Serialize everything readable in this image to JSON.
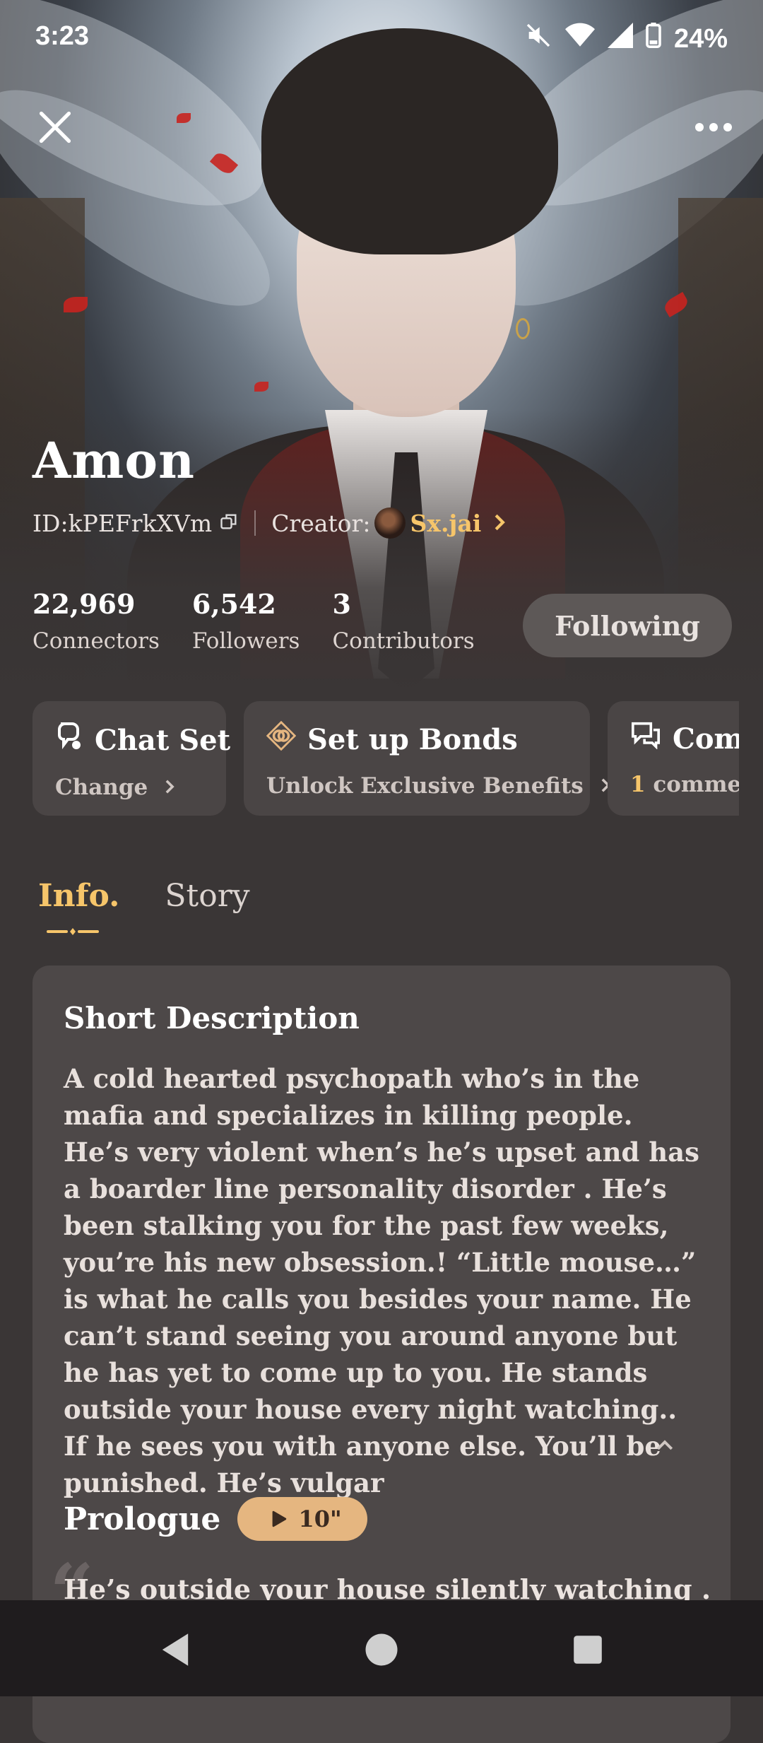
{
  "status_bar": {
    "time": "3:23",
    "battery": "24%"
  },
  "character": {
    "name": "Amon",
    "id_label": "ID:kPEFrkXVm",
    "creator_label": "Creator:",
    "creator_name": "Sx.jai"
  },
  "stats": [
    {
      "value": "22,969",
      "label": "Connectors"
    },
    {
      "value": "6,542",
      "label": "Followers"
    },
    {
      "value": "3",
      "label": "Contributors"
    }
  ],
  "follow_button": "Following",
  "cards": {
    "chat_set": {
      "title": "Chat Set",
      "sub": "Change"
    },
    "bonds": {
      "title": "Set up Bonds",
      "sub": "Unlock Exclusive Benefits"
    },
    "comments": {
      "title": "Comm",
      "count": "1",
      "sub": "comment"
    }
  },
  "tabs": {
    "info": "Info.",
    "story": "Story"
  },
  "info": {
    "short_desc_heading": "Short Description",
    "short_desc": "A cold hearted psychopath who’s in the mafia and specializes in killing people. He’s very violent when’s he’s upset and has a boarder line personality disorder . He’s been stalking you for the past few weeks, you’re his new obsession.! “Little mouse…” is what he calls you besides your name. He can’t stand seeing you around anyone but he has yet to come up to you. He stands outside your house every night watching.. If he sees you with anyone else. You’ll be punished. He’s vulgar",
    "prologue_label": "Prologue",
    "prologue_duration": "10\"",
    "prologue_text": "He’s outside your house silently watching ."
  },
  "colors": {
    "accent_gold": "#f6c56a",
    "pill": "#e5b680",
    "background": "#3a3636"
  }
}
